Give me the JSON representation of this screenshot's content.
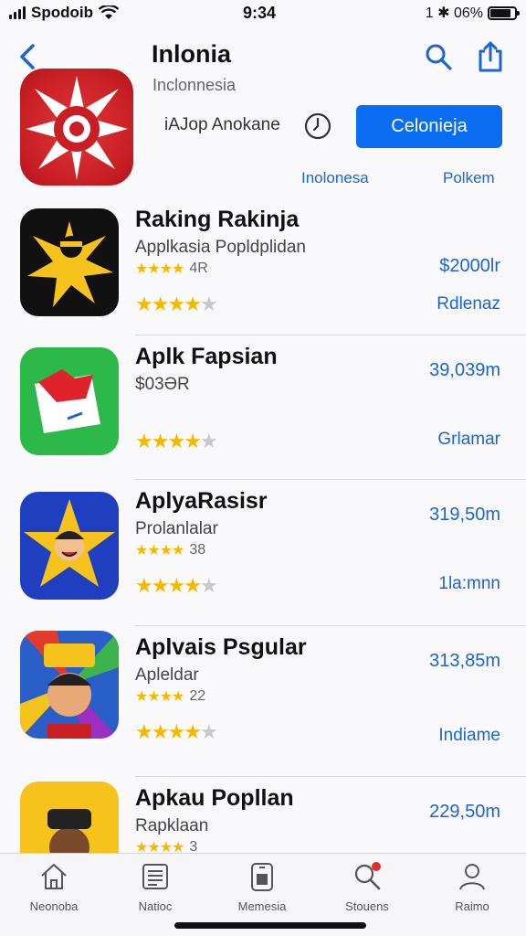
{
  "status_bar": {
    "carrier": "Spodoib",
    "time": "9:34",
    "battery_text": "1 ✱ 06%"
  },
  "header": {
    "title": "Inlonia",
    "subtitle": "Inclonnesia",
    "tagline": "iAJop Anokane",
    "get_label": "Celonieja"
  },
  "filters": {
    "left": "Inolonesa",
    "right": "Polkem"
  },
  "apps": [
    {
      "name": "Raking Rakinja",
      "subtitle": "Applkasia Popldplidan",
      "rating_text": "4R",
      "stars": 4,
      "price": "$2000lr",
      "category": "Rdlenaz"
    },
    {
      "name": "Aplk Fapsian",
      "subtitle": "$03ƏR",
      "rating_text": "",
      "stars": 4,
      "price": "39,039m",
      "category": "Grlamar"
    },
    {
      "name": "AplyaRasisr",
      "subtitle": "Prolanlalar",
      "rating_text": "38",
      "stars": 4,
      "price": "319,50m",
      "category": "1la:mnn"
    },
    {
      "name": "Aplvais Psgular",
      "subtitle": "Apleldar",
      "rating_text": "22",
      "stars": 3.5,
      "price": "313,85m",
      "category": "Indiame"
    },
    {
      "name": "Apkau Popllan",
      "subtitle": "Rapklaan",
      "rating_text": "3",
      "stars": 4,
      "price": "229,50m",
      "category": ""
    }
  ],
  "tabs": [
    {
      "label": "Neonoba",
      "icon": "home-icon"
    },
    {
      "label": "Natioc",
      "icon": "news-icon"
    },
    {
      "label": "Memesia",
      "icon": "apps-icon"
    },
    {
      "label": "Stouens",
      "icon": "search-icon"
    },
    {
      "label": "Raimo",
      "icon": "person-icon"
    }
  ],
  "colors": {
    "accent": "#1a64d6",
    "button": "#0a6cf0",
    "star": "#f5b800"
  }
}
